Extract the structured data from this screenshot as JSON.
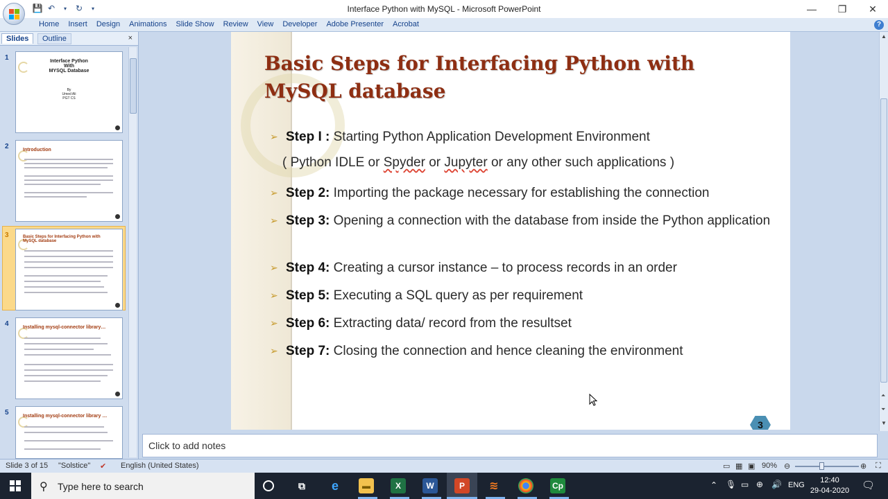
{
  "window": {
    "title": "Interface Python with MySQL - Microsoft PowerPoint",
    "controls": [
      "—",
      "❐",
      "✕"
    ]
  },
  "ribbon": {
    "tabs": [
      "Home",
      "Insert",
      "Design",
      "Animations",
      "Slide Show",
      "Review",
      "View",
      "Developer",
      "Adobe Presenter",
      "Acrobat"
    ]
  },
  "panel": {
    "tab_slides": "Slides",
    "tab_outline": "Outline",
    "close": "×",
    "thumbs": [
      {
        "num": "1",
        "title": "Interface Python\nWith\nMYSQL Database",
        "sub": "By\nUmed Ali\nPGT CS"
      },
      {
        "num": "2",
        "title": "Introduction"
      },
      {
        "num": "3",
        "title": "Basic Steps for Interfacing Python with MySQL database"
      },
      {
        "num": "4",
        "title": "Installing mysql-connector library…"
      },
      {
        "num": "5",
        "title": "Installing mysql-connector library …"
      }
    ]
  },
  "slide": {
    "title_line1": "Basic Steps for Interfacing Python with",
    "title_line2": "MySQL database",
    "steps": [
      {
        "label": "Step I :",
        "text": "Starting Python Application Development Environment"
      },
      {
        "label": "Step 2:",
        "text": "Importing the package necessary for establishing the connection"
      },
      {
        "label": "Step 3:",
        "text": "Opening a connection with the database from inside the Python application"
      },
      {
        "label": "Step 4:",
        "text": "Creating a cursor instance – to process records in an order"
      },
      {
        "label": "Step 5:",
        "text": "Executing a SQL query as per requirement"
      },
      {
        "label": "Step 6:",
        "text": "Extracting data/ record from the resultset"
      },
      {
        "label": "Step 7:",
        "text": "Closing the connection and hence cleaning the environment"
      }
    ],
    "sub_line": {
      "a": "( Python IDLE or ",
      "b": "Spyder",
      "c": " or ",
      "d": "Jupyter",
      "e": "  or any other such applications )"
    },
    "page_number": "3"
  },
  "notes": {
    "placeholder": "Click to add notes"
  },
  "status": {
    "slide_info": "Slide 3 of 15",
    "theme": "\"Solstice\"",
    "language": "English (United States)",
    "zoom": "90%"
  },
  "taskbar": {
    "search_placeholder": "Type here to search",
    "lang": "ENG",
    "time": "12:40",
    "date": "29-04-2020"
  },
  "colors": {
    "accent": "#15428b",
    "title": "#8e2e12",
    "bullet": "#c79a2d"
  }
}
